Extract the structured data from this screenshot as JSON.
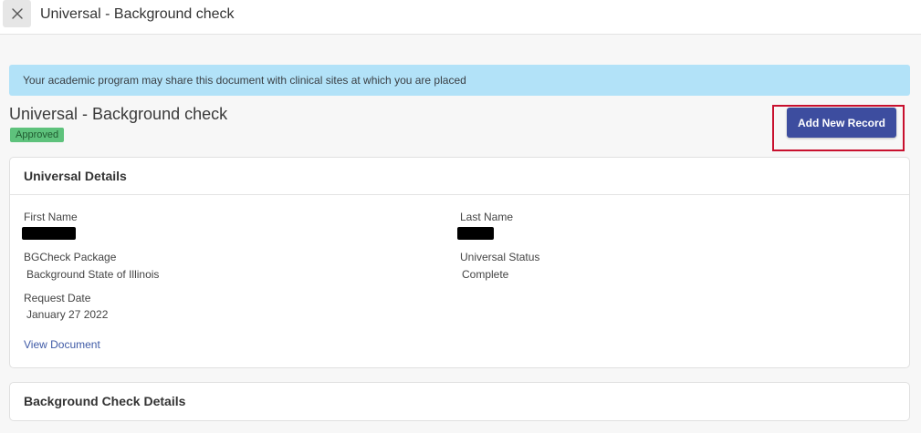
{
  "window": {
    "title": "Universal - Background check",
    "close_icon": "close-icon"
  },
  "banner": {
    "text": "Your academic program may share this document with clinical sites at which you are placed",
    "color": "#b2e2f8"
  },
  "page": {
    "title": "Universal - Background check",
    "status": "Approved",
    "status_color": "#5ec27c"
  },
  "actions": {
    "add_record_label": "Add New Record",
    "accent_color": "#3d4d9f",
    "highlight_color": "#c8102e"
  },
  "details_card": {
    "title": "Universal Details",
    "first_name_label": "First Name",
    "first_name_value": "[redacted]",
    "last_name_label": "Last Name",
    "last_name_value": "[redacted]",
    "package_label": "BGCheck Package",
    "package_value": "Background State of Illinois",
    "status_label": "Universal Status",
    "status_value": "Complete",
    "request_date_label": "Request Date",
    "request_date_value": "January 27 2022",
    "view_document_label": "View Document"
  },
  "bg_card": {
    "title": "Background Check Details"
  }
}
